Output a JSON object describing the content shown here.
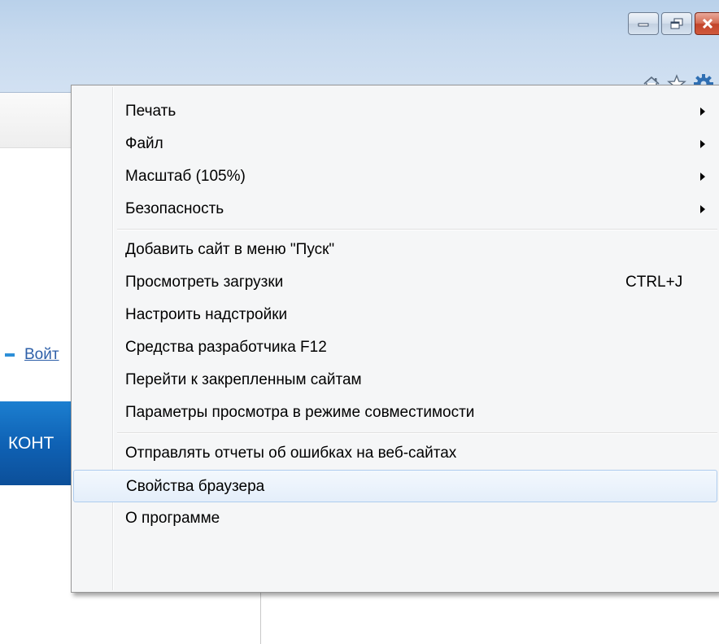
{
  "window": {
    "caption_buttons": [
      "minimize",
      "restore",
      "close"
    ],
    "toolbar_icons": [
      "home-icon",
      "favorites-star-icon",
      "tools-gear-icon"
    ]
  },
  "page": {
    "login_link": "Войт",
    "banner_text": "КОНТ"
  },
  "menu": {
    "groups": [
      [
        {
          "label": "Печать",
          "submenu": true
        },
        {
          "label": "Файл",
          "submenu": true
        },
        {
          "label": "Масштаб (105%)",
          "submenu": true
        },
        {
          "label": "Безопасность",
          "submenu": true
        }
      ],
      [
        {
          "label": "Добавить сайт в меню \"Пуск\""
        },
        {
          "label": "Просмотреть загрузки",
          "shortcut": "CTRL+J"
        },
        {
          "label": "Настроить надстройки"
        },
        {
          "label": "Средства разработчика F12"
        },
        {
          "label": "Перейти к закрепленным сайтам"
        },
        {
          "label": "Параметры просмотра в режиме совместимости"
        }
      ],
      [
        {
          "label": "Отправлять отчеты об ошибках на веб-сайтах"
        },
        {
          "label": "Свойства браузера",
          "highlighted": true
        },
        {
          "label": "О программе"
        }
      ]
    ]
  },
  "colors": {
    "highlight_border": "#aeccee",
    "close_button": "#c2442a",
    "banner": "#0f62b5",
    "link": "#2d5fa8"
  }
}
